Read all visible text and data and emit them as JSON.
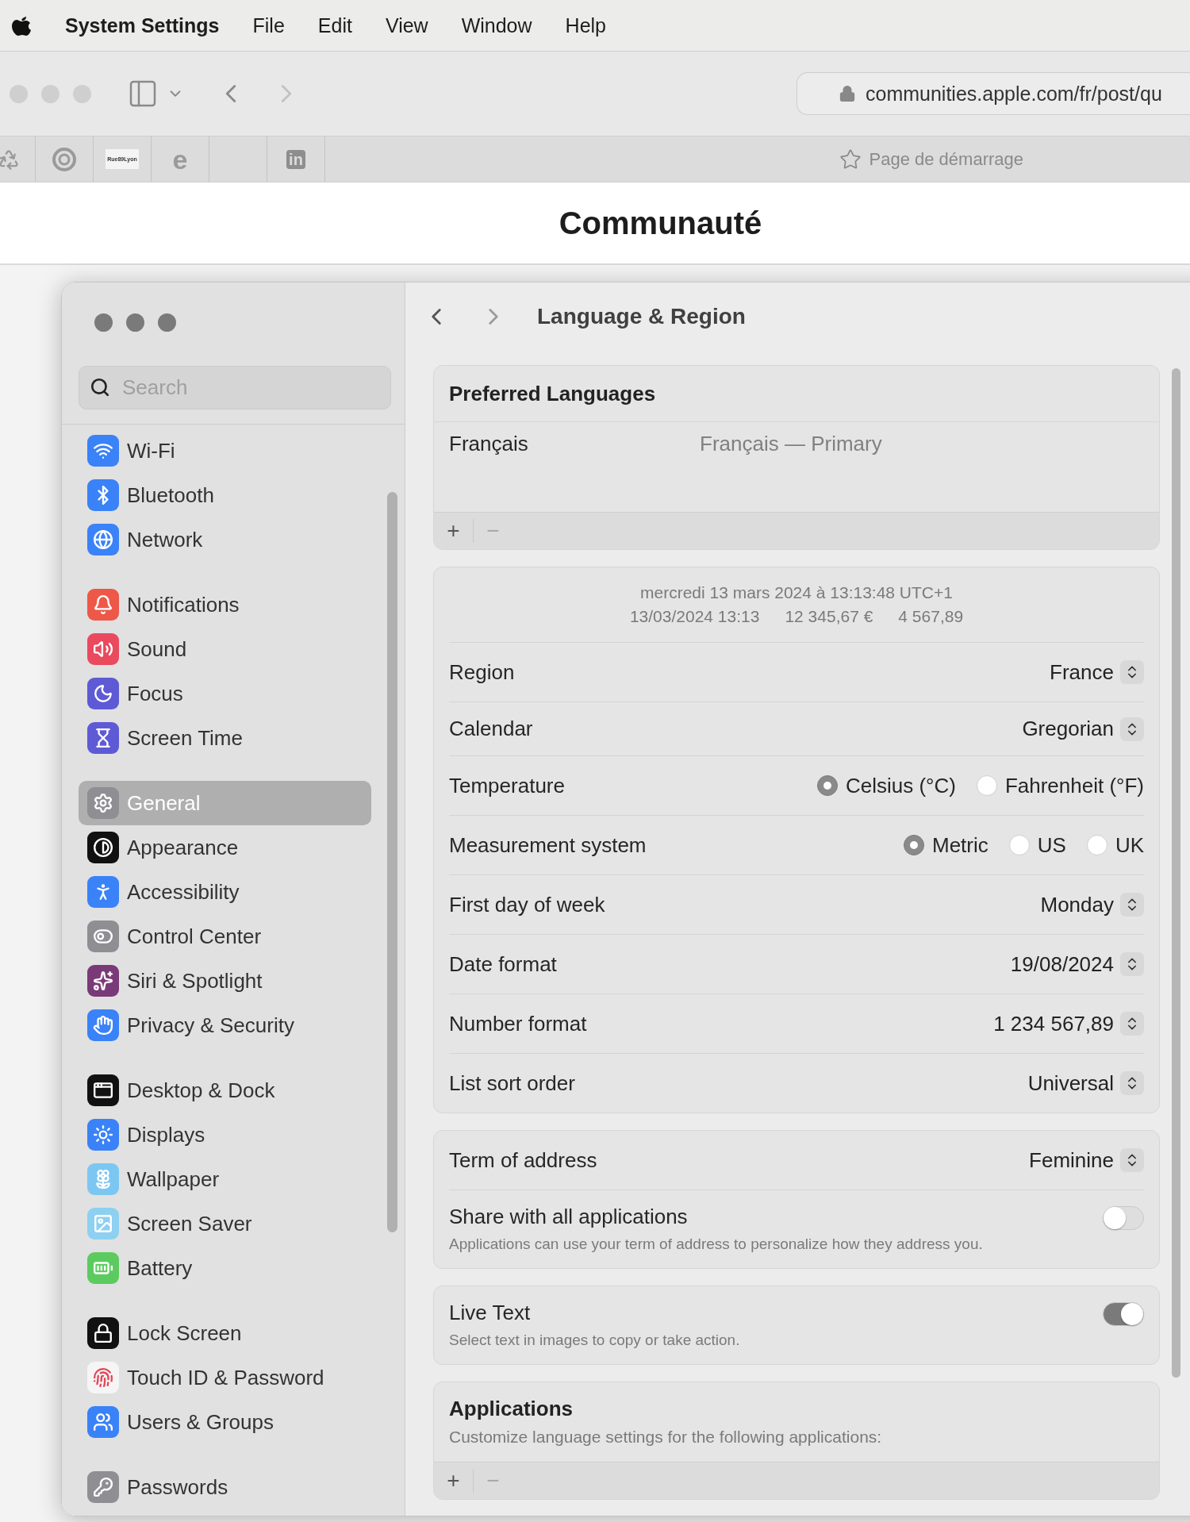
{
  "menu_bar": {
    "app": "System Settings",
    "items": [
      "File",
      "Edit",
      "View",
      "Window",
      "Help"
    ]
  },
  "browser": {
    "url": "communities.apple.com/fr/post/qu",
    "bookmarks": [
      {
        "kind": "recycle"
      },
      {
        "kind": "ring"
      },
      {
        "kind": "wordmark",
        "label": "Rue89Lyon"
      },
      {
        "kind": "letter",
        "label": "e"
      },
      {
        "kind": "blank"
      },
      {
        "kind": "square",
        "label": "in"
      }
    ],
    "start_page": "Page de démarrage"
  },
  "page": {
    "title": "Communauté"
  },
  "settings": {
    "search_placeholder": "Search",
    "title": "Language & Region",
    "sidebar_groups": [
      [
        {
          "kind": "wifi",
          "label": "Wi-Fi",
          "selected": false
        },
        {
          "kind": "bluetooth",
          "label": "Bluetooth",
          "selected": false
        },
        {
          "kind": "network",
          "label": "Network",
          "selected": false
        }
      ],
      [
        {
          "kind": "notifications",
          "label": "Notifications",
          "selected": false
        },
        {
          "kind": "sound",
          "label": "Sound",
          "selected": false
        },
        {
          "kind": "focus",
          "label": "Focus",
          "selected": false
        },
        {
          "kind": "screentime",
          "label": "Screen Time",
          "selected": false
        }
      ],
      [
        {
          "kind": "general",
          "label": "General",
          "selected": true
        },
        {
          "kind": "appearance",
          "label": "Appearance",
          "selected": false
        },
        {
          "kind": "accessibility",
          "label": "Accessibility",
          "selected": false
        },
        {
          "kind": "control",
          "label": "Control Center",
          "selected": false
        },
        {
          "kind": "siri",
          "label": "Siri & Spotlight",
          "selected": false
        },
        {
          "kind": "privacy",
          "label": "Privacy & Security",
          "selected": false
        }
      ],
      [
        {
          "kind": "desktop",
          "label": "Desktop & Dock",
          "selected": false
        },
        {
          "kind": "displays",
          "label": "Displays",
          "selected": false
        },
        {
          "kind": "wallpaper",
          "label": "Wallpaper",
          "selected": false
        },
        {
          "kind": "screensaver",
          "label": "Screen Saver",
          "selected": false
        },
        {
          "kind": "battery",
          "label": "Battery",
          "selected": false
        }
      ],
      [
        {
          "kind": "lock",
          "label": "Lock Screen",
          "selected": false
        },
        {
          "kind": "touchid",
          "label": "Touch ID & Password",
          "selected": false
        },
        {
          "kind": "users",
          "label": "Users & Groups",
          "selected": false
        }
      ],
      [
        {
          "kind": "passwords",
          "label": "Passwords",
          "selected": false
        }
      ]
    ],
    "preferred_languages": {
      "title": "Preferred Languages",
      "languages": [
        {
          "name": "Français",
          "detail": "Français — Primary"
        }
      ],
      "add": "+",
      "remove": "−"
    },
    "preview": {
      "line_1": "mercredi 13 mars 2024 à 13:13:48 UTC+1",
      "line_2": [
        "13/03/2024 13:13",
        "12 345,67 €",
        "4 567,89"
      ]
    },
    "rows": [
      {
        "kind": "popup",
        "label": "Region",
        "value": "France"
      },
      {
        "kind": "popup",
        "label": "Calendar",
        "value": "Gregorian"
      },
      {
        "kind": "radio",
        "label": "Temperature",
        "options": [
          {
            "label": "Celsius (°C)",
            "selected": true
          },
          {
            "label": "Fahrenheit (°F)",
            "selected": false
          }
        ]
      },
      {
        "kind": "radio",
        "label": "Measurement system",
        "options": [
          {
            "label": "Metric",
            "selected": true
          },
          {
            "label": "US",
            "selected": false
          },
          {
            "label": "UK",
            "selected": false
          }
        ]
      },
      {
        "kind": "popup",
        "label": "First day of week",
        "value": "Monday"
      },
      {
        "kind": "popup",
        "label": "Date format",
        "value": "19/08/2024"
      },
      {
        "kind": "popup",
        "label": "Number format",
        "value": "1 234 567,89"
      },
      {
        "kind": "popup",
        "label": "List sort order",
        "value": "Universal"
      }
    ],
    "address": {
      "label": "Term of address",
      "value": "Feminine",
      "share": {
        "title": "Share with all applications",
        "description": "Applications can use your term of address to personalize how they address you.",
        "on": false
      }
    },
    "live_text": {
      "title": "Live Text",
      "description": "Select text in images to copy or take action.",
      "on": true
    },
    "applications": {
      "title": "Applications",
      "description": "Customize language settings for the following applications:",
      "add": "+",
      "remove": "−"
    }
  }
}
